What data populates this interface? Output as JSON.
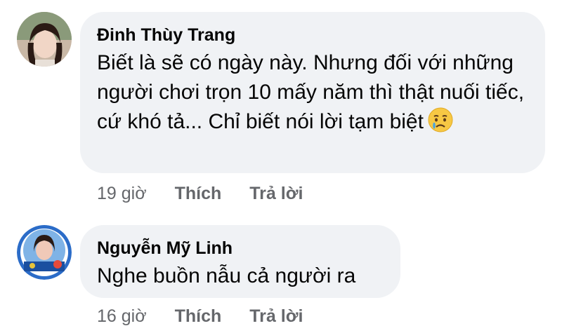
{
  "comments": [
    {
      "author": "Đinh Thùy Trang",
      "text": "Biết là sẽ có ngày này. Nhưng đối với những người chơi trọn 10 mấy năm thì thật nuối tiếc, cứ khó tả... Chỉ biết nói lời tạm biệt",
      "emoji": "sad-tear-emoji",
      "time": "19 giờ",
      "like_label": "Thích",
      "reply_label": "Trả lời"
    },
    {
      "author": "Nguyễn Mỹ Linh",
      "text": "Nghe buồn nẫu cả người ra",
      "time": "16 giờ",
      "like_label": "Thích",
      "reply_label": "Trả lời"
    }
  ],
  "colors": {
    "bubble": "#f0f2f5",
    "text": "#050505",
    "meta": "#65676b"
  }
}
